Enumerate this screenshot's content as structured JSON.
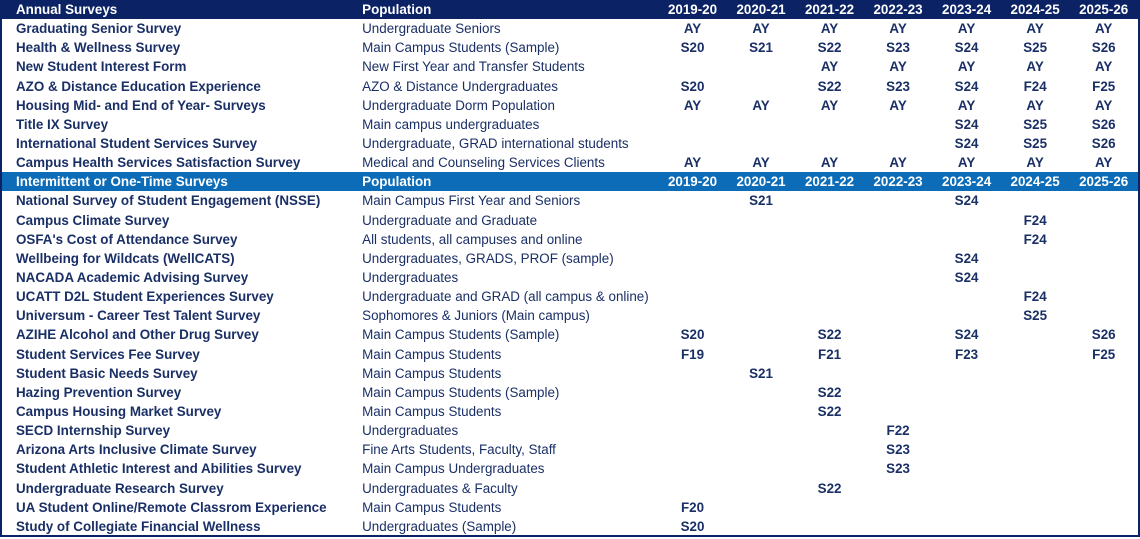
{
  "years": [
    "2019-20",
    "2020-21",
    "2021-22",
    "2022-23",
    "2023-24",
    "2024-25",
    "2025-26"
  ],
  "colors": {
    "annual_header": "#0b2265",
    "intermittent_header": "#0c6cb8",
    "text": "#1a2f66"
  },
  "annual": {
    "title": "Annual Surveys",
    "population_label": "Population",
    "rows": [
      {
        "name": "Graduating Senior Survey",
        "population": "Undergraduate Seniors",
        "cells": [
          "AY",
          "AY",
          "AY",
          "AY",
          "AY",
          "AY",
          "AY"
        ]
      },
      {
        "name": "Health & Wellness Survey",
        "population": "Main Campus Students (Sample)",
        "cells": [
          "S20",
          "S21",
          "S22",
          "S23",
          "S24",
          "S25",
          "S26"
        ]
      },
      {
        "name": "New Student Interest Form",
        "population": "New First Year and Transfer Students",
        "cells": [
          "",
          "",
          "AY",
          "AY",
          "AY",
          "AY",
          "AY"
        ]
      },
      {
        "name": "AZO & Distance Education Experience",
        "population": "AZO & Distance Undergraduates",
        "cells": [
          "S20",
          "",
          "S22",
          "S23",
          "S24",
          "F24",
          "F25"
        ]
      },
      {
        "name": "Housing Mid- and End of Year- Surveys",
        "population": "Undergraduate Dorm Population",
        "cells": [
          "AY",
          "AY",
          "AY",
          "AY",
          "AY",
          "AY",
          "AY"
        ]
      },
      {
        "name": "Title IX Survey",
        "population": "Main campus undergraduates",
        "cells": [
          "",
          "",
          "",
          "",
          "S24",
          "S25",
          "S26"
        ]
      },
      {
        "name": "International Student Services Survey",
        "population": "Undergraduate, GRAD international students",
        "cells": [
          "",
          "",
          "",
          "",
          "S24",
          "S25",
          "S26"
        ]
      },
      {
        "name": "Campus Health Services Satisfaction Survey",
        "population": "Medical and Counseling Services Clients",
        "cells": [
          "AY",
          "AY",
          "AY",
          "AY",
          "AY",
          "AY",
          "AY"
        ]
      }
    ]
  },
  "intermittent": {
    "title": "Intermittent or One-Time Surveys",
    "population_label": "Population",
    "rows": [
      {
        "name": "National Survey of Student Engagement (NSSE)",
        "population": "Main Campus First Year and Seniors",
        "cells": [
          "",
          "S21",
          "",
          "",
          "S24",
          "",
          ""
        ]
      },
      {
        "name": "Campus Climate Survey",
        "population": "Undergraduate and Graduate",
        "cells": [
          "",
          "",
          "",
          "",
          "",
          "F24",
          ""
        ]
      },
      {
        "name": "OSFA's Cost of Attendance Survey",
        "population": "All students, all campuses and online",
        "cells": [
          "",
          "",
          "",
          "",
          "",
          "F24",
          ""
        ]
      },
      {
        "name": "Wellbeing for Wildcats (WellCATS)",
        "population": "Undergraduates, GRADS, PROF (sample)",
        "cells": [
          "",
          "",
          "",
          "",
          "S24",
          "",
          ""
        ]
      },
      {
        "name": "NACADA Academic Advising Survey",
        "population": "Undergraduates",
        "cells": [
          "",
          "",
          "",
          "",
          "S24",
          "",
          ""
        ]
      },
      {
        "name": "UCATT D2L Student Experiences Survey",
        "population": "Undergraduate and GRAD (all campus & online)",
        "cells": [
          "",
          "",
          "",
          "",
          "",
          "F24",
          ""
        ]
      },
      {
        "name": "Universum - Career Test Talent Survey",
        "population": "Sophomores & Juniors (Main campus)",
        "cells": [
          "",
          "",
          "",
          "",
          "",
          "S25",
          ""
        ]
      },
      {
        "name": "AZIHE Alcohol and Other Drug Survey",
        "population": "Main Campus Students (Sample)",
        "cells": [
          "S20",
          "",
          "S22",
          "",
          "S24",
          "",
          "S26"
        ]
      },
      {
        "name": "Student Services Fee Survey",
        "population": "Main Campus Students",
        "cells": [
          "F19",
          "",
          "F21",
          "",
          "F23",
          "",
          "F25"
        ]
      },
      {
        "name": "Student Basic Needs Survey",
        "population": "Main Campus Students",
        "cells": [
          "",
          "S21",
          "",
          "",
          "",
          "",
          ""
        ]
      },
      {
        "name": "Hazing Prevention Survey",
        "population": "Main Campus Students (Sample)",
        "cells": [
          "",
          "",
          "S22",
          "",
          "",
          "",
          ""
        ]
      },
      {
        "name": "Campus Housing Market Survey",
        "population": "Main Campus Students",
        "cells": [
          "",
          "",
          "S22",
          "",
          "",
          "",
          ""
        ]
      },
      {
        "name": "SECD Internship Survey",
        "population": "Undergraduates",
        "cells": [
          "",
          "",
          "",
          "F22",
          "",
          "",
          ""
        ]
      },
      {
        "name": "Arizona Arts Inclusive Climate Survey",
        "population": "Fine Arts Students, Faculty, Staff",
        "cells": [
          "",
          "",
          "",
          "S23",
          "",
          "",
          ""
        ]
      },
      {
        "name": "Student Athletic Interest and Abilities Survey",
        "population": "Main Campus Undergraduates",
        "cells": [
          "",
          "",
          "",
          "S23",
          "",
          "",
          ""
        ]
      },
      {
        "name": "Undergraduate Research Survey",
        "population": "Undergraduates & Faculty",
        "cells": [
          "",
          "",
          "S22",
          "",
          "",
          "",
          ""
        ]
      },
      {
        "name": "UA Student Online/Remote Classrom Experience",
        "population": "Main Campus Students",
        "cells": [
          "F20",
          "",
          "",
          "",
          "",
          "",
          ""
        ]
      },
      {
        "name": "Study of Collegiate Financial Wellness",
        "population": "Undergraduates (Sample)",
        "cells": [
          "S20",
          "",
          "",
          "",
          "",
          "",
          ""
        ]
      }
    ]
  }
}
